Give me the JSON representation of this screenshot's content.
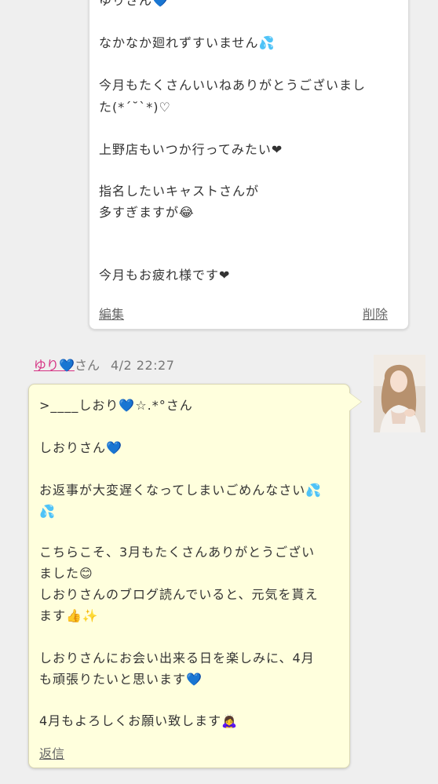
{
  "first_message": {
    "lines": [
      "ゆりさん💙",
      "なかなか廻れずすいません💦",
      "今月もたくさんいいねありがとうございまし",
      "た(*´˘`*)♡",
      "上野店もいつか行ってみたい❤",
      "指名したいキャストさんが",
      "多すぎますが😂",
      "今月もお疲れ様です❤"
    ],
    "edit_label": "編集",
    "delete_label": "削除"
  },
  "second_message": {
    "sender_name": "ゆり💙",
    "sender_suffix": "さん",
    "timestamp": "4/2 22:27",
    "lines": [
      ">____しおり💙☆.*°さん",
      "しおりさん💙",
      "お返事が大変遅くなってしまいごめんなさい💦",
      "💦",
      "こちらこそ、3月もたくさんありがとうござい",
      "ました😊",
      "しおりさんのブログ読んでいると、元気を貰え",
      "ます👍✨",
      "しおりさんにお会い出来る日を楽しみに、4月",
      "も頑張りたいと思います💙",
      "4月もよろしくお願い致します🙇‍♀️"
    ],
    "reply_label": "返信"
  },
  "colors": {
    "page_bg": "#efefef",
    "card_white": "#ffffff",
    "card_yellow": "#ffffdd",
    "sender_pink": "#d63384",
    "link_gray": "#666666"
  },
  "icons": {
    "avatar": "avatar-photo"
  }
}
